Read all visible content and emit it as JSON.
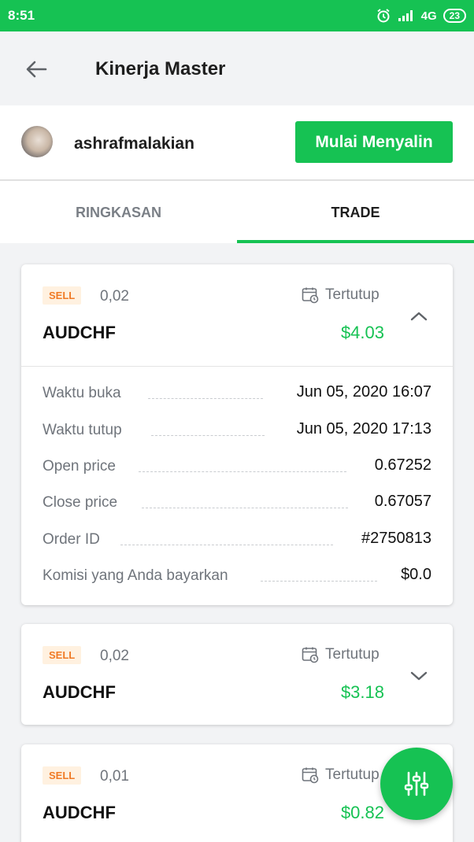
{
  "status_bar": {
    "time": "8:51",
    "network": "4G",
    "battery": "23"
  },
  "app_bar": {
    "title": "Kinerja Master"
  },
  "profile": {
    "username": "ashrafmalakian",
    "copy_button": "Mulai Menyalin"
  },
  "tabs": [
    {
      "label": "RINGKASAN",
      "active": false
    },
    {
      "label": "TRADE",
      "active": true
    }
  ],
  "trades": [
    {
      "side": "SELL",
      "lot": "0,02",
      "status": "Tertutup",
      "symbol": "AUDCHF",
      "profit": "$4.03",
      "expanded": true,
      "details": [
        {
          "label": "Waktu buka",
          "value": "Jun 05, 2020 16:07"
        },
        {
          "label": "Waktu tutup",
          "value": "Jun 05, 2020 17:13"
        },
        {
          "label": "Open price",
          "value": "0.67252"
        },
        {
          "label": "Close price",
          "value": "0.67057"
        },
        {
          "label": "Order ID",
          "value": "#2750813"
        },
        {
          "label": "Komisi yang Anda bayarkan",
          "value": "$0.0"
        }
      ]
    },
    {
      "side": "SELL",
      "lot": "0,02",
      "status": "Tertutup",
      "symbol": "AUDCHF",
      "profit": "$3.18",
      "expanded": false
    },
    {
      "side": "SELL",
      "lot": "0,01",
      "status": "Tertutup",
      "symbol": "AUDCHF",
      "profit": "$0.82",
      "expanded": false
    }
  ],
  "colors": {
    "accent": "#16c253",
    "sell_badge": "#f07a25",
    "muted_text": "#6f747b"
  },
  "icons": [
    "back-arrow-icon",
    "calendar-closed-icon",
    "chevron-up-icon",
    "chevron-down-icon",
    "filter-sliders-icon",
    "alarm-icon",
    "signal-icon"
  ]
}
